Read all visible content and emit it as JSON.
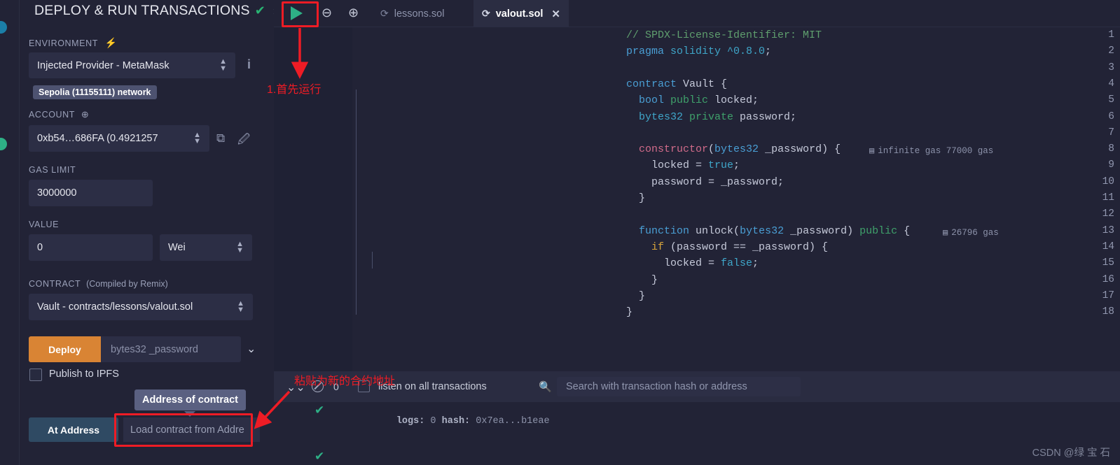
{
  "panel": {
    "title": "DEPLOY & RUN TRANSACTIONS",
    "check_icon": "check-icon",
    "chevron": "›",
    "environment_label": "ENVIRONMENT",
    "plug_icon": "plug-icon",
    "environment_value": "Injected Provider - MetaMask",
    "info_icon": "i",
    "network_badge": "Sepolia (11155111) network",
    "account_label": "ACCOUNT",
    "account_plus_icon": "plus-circle-icon",
    "account_value": "0xb54…686FA (0.4921257​",
    "copy_icon": "copy-icon",
    "edit_icon": "edit-icon",
    "gas_limit_label": "GAS LIMIT",
    "gas_limit_value": "3000000",
    "value_label": "VALUE",
    "value_amount": "0",
    "value_unit": "Wei",
    "contract_label": "CONTRACT",
    "contract_sub_label": "(Compiled by Remix)",
    "contract_value": "Vault - contracts/lessons/valout.sol",
    "deploy_label": "Deploy",
    "deploy_placeholder": "bytes32 _password",
    "deploy_caret": "chevron-down-icon",
    "publish_ipfs_label": "Publish to IPFS",
    "publish_ipfs_checked": false,
    "at_address_label": "At Address",
    "at_address_placeholder": "Load contract from Addre",
    "at_address_tooltip": "Address of contract"
  },
  "toolbar": {
    "run_icon": "play-icon",
    "zoom_out_icon": "zoom-out-icon",
    "zoom_in_icon": "zoom-in-icon"
  },
  "tabs": [
    {
      "label": "lessons.sol",
      "icon": "solidity-icon",
      "active": false,
      "closable": false
    },
    {
      "label": "valout.sol",
      "icon": "solidity-icon",
      "active": true,
      "closable": true,
      "close_icon": "close-icon"
    }
  ],
  "editor": {
    "line_numbers": [
      1,
      2,
      3,
      4,
      5,
      6,
      7,
      8,
      9,
      10,
      11,
      12,
      13,
      14,
      15,
      16,
      17,
      18
    ],
    "lines": [
      [
        {
          "t": "// SPDX-License-Identifier: MIT",
          "c": "t-cmt"
        }
      ],
      [
        {
          "t": "pragma ",
          "c": "t-kw"
        },
        {
          "t": "solidity ",
          "c": "t-kw2"
        },
        {
          "t": "^0.8.0",
          "c": "t-kw2"
        },
        {
          "t": ";",
          "c": "t-pnc"
        }
      ],
      [],
      [
        {
          "t": "contract ",
          "c": "t-kw"
        },
        {
          "t": "Vault ",
          "c": "t-pln"
        },
        {
          "t": "{",
          "c": "t-pnc"
        }
      ],
      [
        {
          "t": "  bool ",
          "c": "t-kw"
        },
        {
          "t": "public ",
          "c": "t-grn"
        },
        {
          "t": "locked",
          "c": "t-pln"
        },
        {
          "t": ";",
          "c": "t-pnc"
        }
      ],
      [
        {
          "t": "  bytes32 ",
          "c": "t-kw2"
        },
        {
          "t": "private ",
          "c": "t-grn"
        },
        {
          "t": "password",
          "c": "t-pln"
        },
        {
          "t": ";",
          "c": "t-pnc"
        }
      ],
      [],
      [
        {
          "t": "  constructor",
          "c": "t-fn"
        },
        {
          "t": "(",
          "c": "t-pnc"
        },
        {
          "t": "bytes32 ",
          "c": "t-typ"
        },
        {
          "t": "_password",
          "c": "t-pln"
        },
        {
          "t": ") {",
          "c": "t-pnc"
        }
      ],
      [
        {
          "t": "    locked = ",
          "c": "t-pln"
        },
        {
          "t": "true",
          "c": "t-kw2"
        },
        {
          "t": ";",
          "c": "t-pnc"
        }
      ],
      [
        {
          "t": "    password = _password;",
          "c": "t-pln"
        }
      ],
      [
        {
          "t": "  }",
          "c": "t-pnc"
        }
      ],
      [],
      [
        {
          "t": "  function ",
          "c": "t-kw"
        },
        {
          "t": "unlock",
          "c": "t-pln"
        },
        {
          "t": "(",
          "c": "t-pnc"
        },
        {
          "t": "bytes32 ",
          "c": "t-typ"
        },
        {
          "t": "_password",
          "c": "t-pln"
        },
        {
          "t": ") ",
          "c": "t-pnc"
        },
        {
          "t": "public ",
          "c": "t-grn"
        },
        {
          "t": "{",
          "c": "t-pnc"
        }
      ],
      [
        {
          "t": "    if ",
          "c": "t-yel"
        },
        {
          "t": "(password == _password) {",
          "c": "t-pln"
        }
      ],
      [
        {
          "t": "      locked = ",
          "c": "t-pln"
        },
        {
          "t": "false",
          "c": "t-kw2"
        },
        {
          "t": ";",
          "c": "t-pnc"
        }
      ],
      [
        {
          "t": "    }",
          "c": "t-pnc"
        }
      ],
      [
        {
          "t": "  }",
          "c": "t-pnc"
        }
      ],
      [
        {
          "t": "}",
          "c": "t-pnc"
        }
      ]
    ],
    "gas_notes": [
      {
        "line": 8,
        "icon": "gas-icon",
        "text": "infinite gas 77000 gas"
      },
      {
        "line": 13,
        "icon": "gas-icon",
        "text": "26796 gas"
      }
    ]
  },
  "terminal": {
    "collapse_icon": "chevron-double-down-icon",
    "clear_icon": "ban-icon",
    "count": "0",
    "listen_label": "listen on all transactions",
    "listen_checked": false,
    "search_icon": "search-icon",
    "search_placeholder": "Search with transaction hash or address",
    "log_status_icon": "check-circle-icon",
    "log_text_a": "logs:",
    "log_text_b": " 0 ",
    "log_text_c": "hash:",
    "log_text_d": " 0x7ea...b1eae"
  },
  "annotations": {
    "step1": "1.首先运行",
    "step2": "粘贴为新的合约地址",
    "color": "#ee1c25"
  },
  "watermark": "CSDN @绿 宝 石",
  "colors": {
    "panel_bg": "#222336",
    "field_bg": "#2c2e45",
    "deploy_orange": "#d98434",
    "at_address_blue": "#2f4a63",
    "accent_green": "#29b473",
    "annotation_red": "#ee1c25"
  }
}
